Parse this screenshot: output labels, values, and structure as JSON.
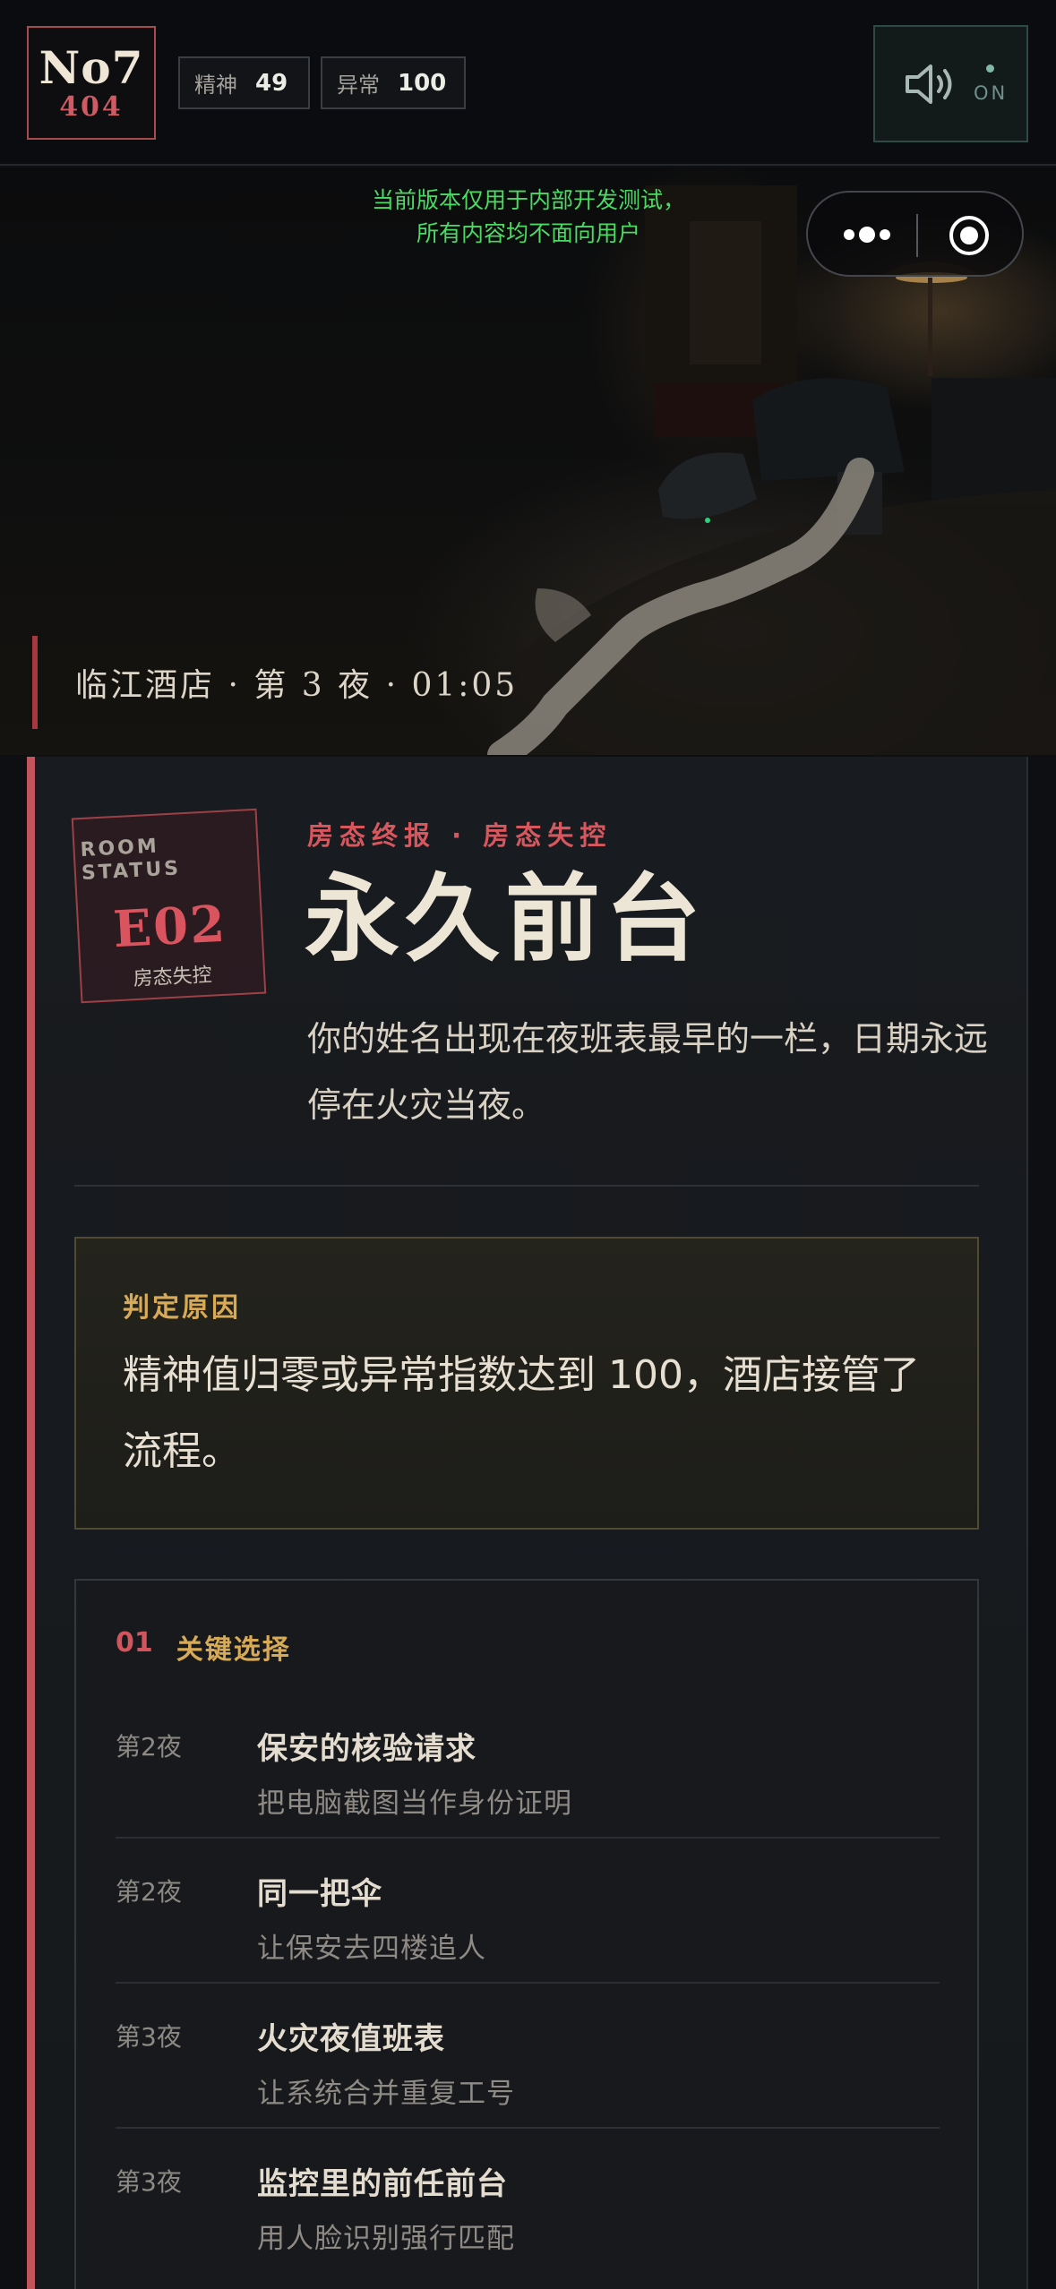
{
  "header": {
    "logo_top": "No7",
    "logo_bottom": "404",
    "stats": [
      {
        "label": "精神",
        "value": "49"
      },
      {
        "label": "异常",
        "value": "100"
      }
    ],
    "sound": {
      "icon": "speaker-icon",
      "state": "ON"
    }
  },
  "hero": {
    "notice_line1": "当前版本仅用于内部开发测试，",
    "notice_line2": "所有内容均不面向用户",
    "location": "临江酒店 · 第 3 夜 · 01:05"
  },
  "ending": {
    "stamp_label_line1": "ROOM",
    "stamp_label_line2": "STATUS",
    "stamp_code": "E02",
    "stamp_sub": "房态失控",
    "kicker": "房态终报 · 房态失控",
    "title": "永久前台",
    "description": "你的姓名出现在夜班表最早的一栏，日期永远停在火灾当夜。"
  },
  "reason": {
    "heading": "判定原因",
    "text": "精神值归零或异常指数达到 100，酒店接管了流程。"
  },
  "choices": {
    "index": "01",
    "heading": "关键选择",
    "items": [
      {
        "night": "第2夜",
        "name": "保安的核验请求",
        "detail": "把电脑截图当作身份证明"
      },
      {
        "night": "第2夜",
        "name": "同一把伞",
        "detail": "让保安去四楼追人"
      },
      {
        "night": "第3夜",
        "name": "火灾夜值班表",
        "detail": "让系统合并重复工号"
      },
      {
        "night": "第3夜",
        "name": "监控里的前任前台",
        "detail": "用人脸识别强行匹配"
      }
    ]
  },
  "colors": {
    "accent_red": "#c2555b",
    "accent_gold": "#d9aa55",
    "notice_green": "#4cd964"
  }
}
